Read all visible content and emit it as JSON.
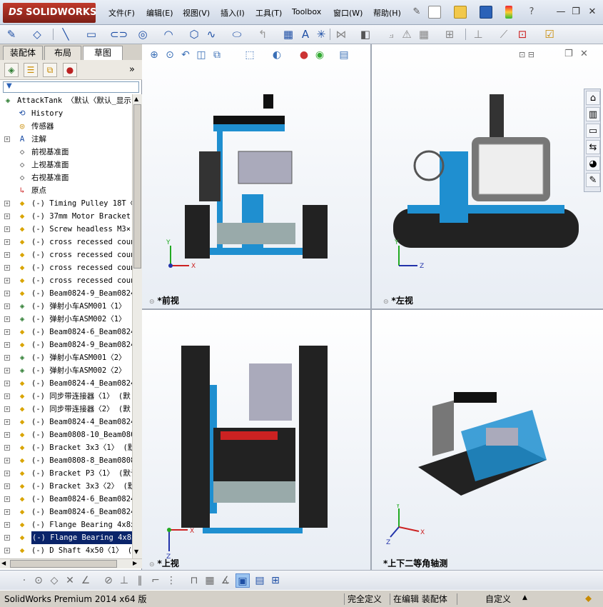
{
  "app": {
    "logo_ds": "DS",
    "logo_text": "SOLIDWORKS"
  },
  "menu": [
    "文件(F)",
    "编辑(E)",
    "视图(V)",
    "插入(I)",
    "工具(T)",
    "Toolbox",
    "窗口(W)",
    "帮助(H)"
  ],
  "left_panel": {
    "tabs": [
      "装配体",
      "布局",
      "草图"
    ],
    "active_tab": "草图",
    "collapse_glyph": "»",
    "tree": [
      {
        "label": "AttackTank  〈默认〈默认_显示",
        "icon": "assembly-icon",
        "expand": false,
        "sel": false,
        "root": true
      },
      {
        "label": "History",
        "icon": "history-icon",
        "expand": false,
        "sel": false
      },
      {
        "label": "传感器",
        "icon": "sensor-icon",
        "expand": false,
        "sel": false
      },
      {
        "label": "注解",
        "icon": "annotation-icon",
        "expand": true,
        "sel": false
      },
      {
        "label": "前视基准面",
        "icon": "plane-icon",
        "expand": false,
        "sel": false
      },
      {
        "label": "上视基准面",
        "icon": "plane-icon",
        "expand": false,
        "sel": false
      },
      {
        "label": "右视基准面",
        "icon": "plane-icon",
        "expand": false,
        "sel": false
      },
      {
        "label": "原点",
        "icon": "origin-icon",
        "expand": false,
        "sel": false
      },
      {
        "label": "(-) Timing Pulley 18T〈1",
        "icon": "part-icon",
        "expand": true,
        "sel": false
      },
      {
        "label": "(-) 37mm Motor Bracket",
        "icon": "part-icon",
        "expand": true,
        "sel": false
      },
      {
        "label": "(-) Screw headless M3×",
        "icon": "part-icon",
        "expand": true,
        "sel": false
      },
      {
        "label": "(-) cross recessed coun",
        "icon": "part-icon",
        "expand": true,
        "sel": false
      },
      {
        "label": "(-) cross recessed coun",
        "icon": "part-icon",
        "expand": true,
        "sel": false
      },
      {
        "label": "(-) cross recessed coun",
        "icon": "part-icon",
        "expand": true,
        "sel": false
      },
      {
        "label": "(-) cross recessed coun",
        "icon": "part-icon",
        "expand": true,
        "sel": false
      },
      {
        "label": "(-) Beam0824-9_Beam0824",
        "icon": "part-icon",
        "expand": true,
        "sel": false
      },
      {
        "label": "(-) 弹射小车ASM001〈1〉 (",
        "icon": "subassembly-icon",
        "expand": true,
        "sel": false
      },
      {
        "label": "(-) 弹射小车ASM002〈1〉 (",
        "icon": "subassembly-icon",
        "expand": true,
        "sel": false
      },
      {
        "label": "(-) Beam0824-6_Beam0824",
        "icon": "part-icon",
        "expand": true,
        "sel": false
      },
      {
        "label": "(-) Beam0824-9_Beam0824",
        "icon": "part-icon",
        "expand": true,
        "sel": false
      },
      {
        "label": "(-) 弹射小车ASM001〈2〉 (",
        "icon": "subassembly-icon",
        "expand": true,
        "sel": false
      },
      {
        "label": "(-) 弹射小车ASM002〈2〉 (",
        "icon": "subassembly-icon",
        "expand": true,
        "sel": false
      },
      {
        "label": "(-) Beam0824-4_Beam0824",
        "icon": "part-icon",
        "expand": true,
        "sel": false
      },
      {
        "label": "(-) 同步带连接器〈1〉 (默",
        "icon": "part-icon",
        "expand": true,
        "sel": false
      },
      {
        "label": "(-) 同步带连接器〈2〉 (默",
        "icon": "part-icon",
        "expand": true,
        "sel": false
      },
      {
        "label": "(-) Beam0824-4_Beam0824",
        "icon": "part-icon",
        "expand": true,
        "sel": false
      },
      {
        "label": "(-) Beam0808-10_Beam080",
        "icon": "part-icon",
        "expand": true,
        "sel": false
      },
      {
        "label": "(-) Bracket 3x3〈1〉 (默认",
        "icon": "part-icon",
        "expand": true,
        "sel": false
      },
      {
        "label": "(-) Beam0808-8_Beam0808",
        "icon": "part-icon",
        "expand": true,
        "sel": false
      },
      {
        "label": "(-) Bracket P3〈1〉 (默认",
        "icon": "part-icon",
        "expand": true,
        "sel": false
      },
      {
        "label": "(-) Bracket 3x3〈2〉 (默认",
        "icon": "part-icon",
        "expand": true,
        "sel": false
      },
      {
        "label": "(-) Beam0824-6_Beam0824",
        "icon": "part-icon",
        "expand": true,
        "sel": false
      },
      {
        "label": "(-) Beam0824-6_Beam0824",
        "icon": "part-icon",
        "expand": true,
        "sel": false
      },
      {
        "label": "(-) Flange Bearing 4x8x",
        "icon": "part-icon",
        "expand": true,
        "sel": false
      },
      {
        "label": "(-) Flange Bearing 4x8x",
        "icon": "part-icon",
        "expand": true,
        "sel": true
      },
      {
        "label": "(-) D Shaft 4x50〈1〉 (默",
        "icon": "part-icon",
        "expand": true,
        "sel": false
      }
    ]
  },
  "viewports": [
    {
      "id": "front",
      "label": "*前视",
      "axes": [
        "Y",
        "X"
      ]
    },
    {
      "id": "left",
      "label": "*左视",
      "axes": [
        "Y",
        "Z"
      ]
    },
    {
      "id": "top",
      "label": "*上视",
      "axes": [
        "X",
        "Z"
      ]
    },
    {
      "id": "iso",
      "label": "*上下二等角轴测",
      "axes": [
        "Y",
        "X",
        "Z"
      ]
    }
  ],
  "status": {
    "product": "SolidWorks Premium 2014 x64 版",
    "definition": "完全定义",
    "editing": "在编辑 装配体",
    "units": "自定义"
  },
  "colors": {
    "accent": "#1f8fd0",
    "title_red": "#c0392b",
    "selection": "#0a246a"
  }
}
